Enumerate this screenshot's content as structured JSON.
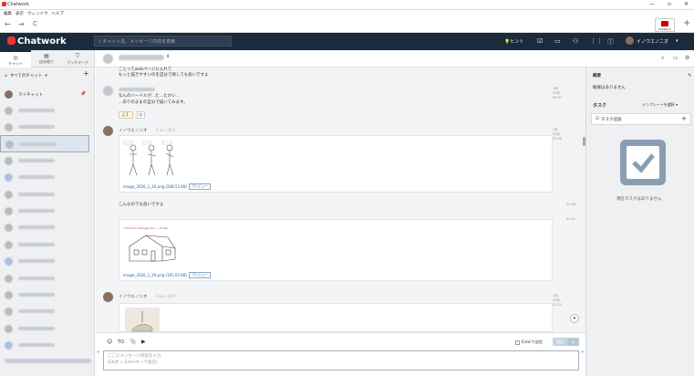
{
  "titlebar": {
    "title": "Chatwork",
    "minimize": "—",
    "maximize": "▫",
    "close": "✕"
  },
  "menu": [
    "編集",
    "表示",
    "ウィンドウ",
    "ヘルプ"
  ],
  "nav": {
    "back": "←",
    "forward": "→",
    "reload": "C",
    "plus": "+",
    "tab_label": "Chatwork"
  },
  "header": {
    "logo": "Chatwork",
    "search_placeholder": "チャット名、メッセージ内容を検索",
    "hint": "ヒント",
    "user": "イノウエノニオ"
  },
  "sidebar": {
    "tabs": [
      {
        "label": "チャット"
      },
      {
        "label": "自分宛て"
      },
      {
        "label": "ブックマーク"
      }
    ],
    "all_chats": "すべてのチャット",
    "add": "+",
    "my_chat": "マイチャット"
  },
  "messages": {
    "m1": {
      "line1": "ことってwebページに入れて",
      "line2": "もっと描きやすいのを自分で探しても良いですよ"
    },
    "m2": {
      "line1": "なんのハードルが...た...たかい...",
      "line2": "...ありのままの自分で描いてみます。",
      "time": "1月20日 20:57",
      "reaction": "1"
    },
    "m3": {
      "who": "イノウエノニオ",
      "reply": "リューゴバ",
      "time": "1月20日 21:00",
      "file": "image_2026_1_20.png (208.53 KB)",
      "preview": "プレビュー"
    },
    "m4": {
      "text": "こんなのでも良いですよ",
      "time1": "21:00",
      "time2": "21:01",
      "file": "image_2026_1_20.png (165.03 KB)",
      "preview": "プレビュー",
      "sketch_title": "The Floor Changes the ... House"
    },
    "m5": {
      "who": "イノウエノニオ",
      "reply": "リューゴバ",
      "time": "1月20日 21:21"
    }
  },
  "compose": {
    "enter_label": "Enterで送信",
    "send": "送信",
    "placeholder1": "ここにメッセージ内容を入力",
    "placeholder2": "(Shift + Enterキーで送信)",
    "to": "TO",
    "collapse": "«",
    "expand": "»"
  },
  "rightpane": {
    "summary_title": "概要",
    "summary_empty": "概要はありません",
    "task_title": "タスク",
    "template": "テンプレートを選択 ▾",
    "task_add": "タスク追加",
    "task_add_plus": "+",
    "no_task": "現在タスクはありません"
  }
}
